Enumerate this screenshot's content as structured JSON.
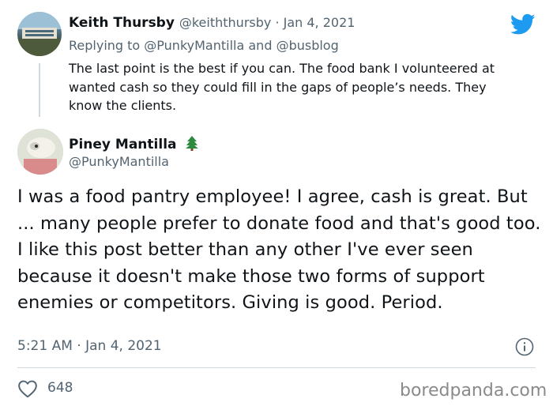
{
  "reply_tweet": {
    "author_name": "Keith Thursby",
    "author_handle": "@keiththursby",
    "separator": " · ",
    "date": "Jan 4, 2021",
    "replying_prefix": "Replying to ",
    "mention_1": "@PunkyMantilla",
    "replying_joiner": " and ",
    "mention_2": "@busblog",
    "text": "The last point is the best if you can. The food bank I volunteered at wanted cash so they could fill in the gaps of people’s needs.  They know the clients."
  },
  "main_tweet": {
    "author_name": "Piney Mantilla",
    "author_emoji_icon": "evergreen-tree-icon",
    "author_handle": "@PunkyMantilla",
    "text": "I was a food pantry employee! I agree, cash is great. But ... many people prefer to donate food and that's good too. I like this post better than any other I've ever seen because it doesn't make those two forms of support enemies or competitors. Giving is good. Period.",
    "timestamp": "5:21 AM · Jan 4, 2021",
    "like_count": "648"
  },
  "icons": {
    "brand": "twitter-bird-icon",
    "info": "info-icon",
    "like": "heart-icon"
  },
  "watermark": "boredpanda.com",
  "colors": {
    "text_primary": "#0f1419",
    "text_secondary": "#536471",
    "twitter_blue": "#1d9bf0",
    "divider": "#cfd9de",
    "watermark": "#8a8a8a"
  }
}
